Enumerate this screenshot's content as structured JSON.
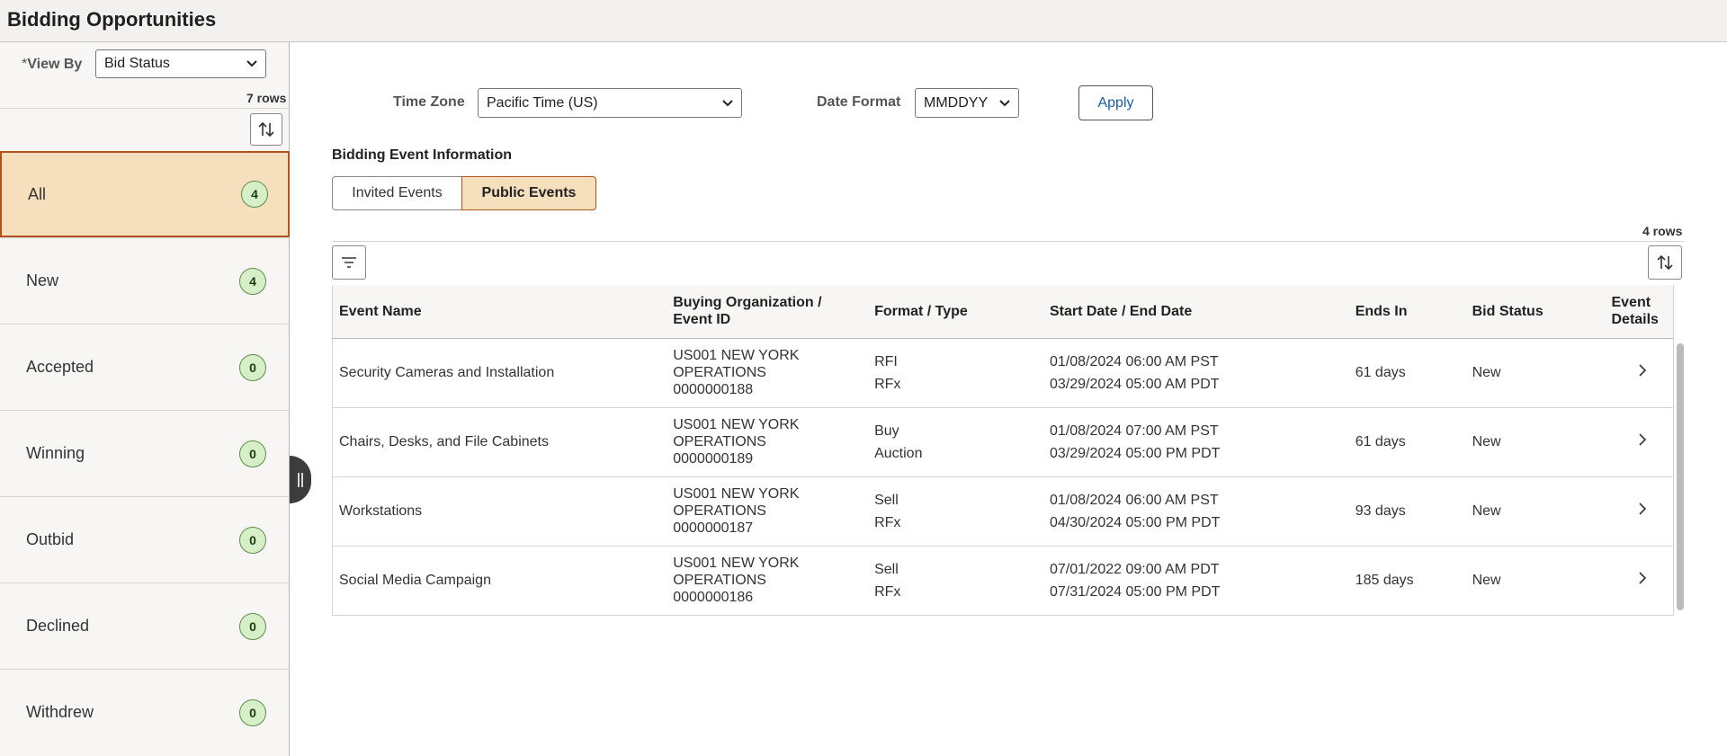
{
  "page": {
    "title": "Bidding Opportunities"
  },
  "sidebar": {
    "view_by_required": "*",
    "view_by_label": "View By",
    "view_by_value": "Bid Status",
    "rows_count": "7 rows",
    "items": [
      {
        "label": "All",
        "count": "4",
        "selected": true
      },
      {
        "label": "New",
        "count": "4"
      },
      {
        "label": "Accepted",
        "count": "0"
      },
      {
        "label": "Winning",
        "count": "0"
      },
      {
        "label": "Outbid",
        "count": "0"
      },
      {
        "label": "Declined",
        "count": "0"
      },
      {
        "label": "Withdrew",
        "count": "0"
      }
    ]
  },
  "filters": {
    "time_zone_label": "Time Zone",
    "time_zone_value": "Pacific Time (US)",
    "date_format_label": "Date Format",
    "date_format_value": "MMDDYY",
    "apply_label": "Apply"
  },
  "section": {
    "title": "Bidding Event Information",
    "tabs": [
      {
        "label": "Invited Events",
        "selected": false
      },
      {
        "label": "Public Events",
        "selected": true
      }
    ]
  },
  "grid": {
    "rows_count": "4 rows",
    "columns": [
      {
        "line1": "Event Name",
        "line2": ""
      },
      {
        "line1": "Buying Organization /",
        "line2": "Event ID"
      },
      {
        "line1": "Format / Type",
        "line2": ""
      },
      {
        "line1": "Start Date / End Date",
        "line2": ""
      },
      {
        "line1": "Ends In",
        "line2": ""
      },
      {
        "line1": "Bid Status",
        "line2": ""
      },
      {
        "line1": "Event",
        "line2": "Details"
      }
    ],
    "rows": [
      {
        "event_name": "Security Cameras and Installation",
        "org_line1": "US001 NEW YORK",
        "org_line2": "OPERATIONS",
        "event_id": "0000000188",
        "format": "RFI",
        "type": "RFx",
        "start": "01/08/2024 06:00 AM PST",
        "end": "03/29/2024 05:00 AM PDT",
        "ends_in": "61 days",
        "bid_status": "New"
      },
      {
        "event_name": "Chairs, Desks, and File Cabinets",
        "org_line1": "US001 NEW YORK",
        "org_line2": "OPERATIONS",
        "event_id": "0000000189",
        "format": "Buy",
        "type": "Auction",
        "start": "01/08/2024 07:00 AM PST",
        "end": "03/29/2024 05:00 PM PDT",
        "ends_in": "61 days",
        "bid_status": "New"
      },
      {
        "event_name": "Workstations",
        "org_line1": "US001 NEW YORK",
        "org_line2": "OPERATIONS",
        "event_id": "0000000187",
        "format": "Sell",
        "type": "RFx",
        "start": "01/08/2024 06:00 AM PST",
        "end": "04/30/2024 05:00 PM PDT",
        "ends_in": "93 days",
        "bid_status": "New"
      },
      {
        "event_name": "Social Media Campaign",
        "org_line1": "US001 NEW YORK",
        "org_line2": "OPERATIONS",
        "event_id": "0000000186",
        "format": "Sell",
        "type": "RFx",
        "start": "07/01/2022 09:00 AM PDT",
        "end": "07/31/2024 05:00 PM PDT",
        "ends_in": "185 days",
        "bid_status": "New"
      }
    ]
  },
  "icons": {
    "sort": "sort-icon",
    "filter": "filter-icon",
    "chevron_down": "chevron-down-icon",
    "chevron_right": "chevron-right-icon",
    "collapse": "collapse-handle-icon"
  },
  "colors": {
    "selected_bg": "#f6dfbd",
    "selected_border": "#b3521c",
    "badge_bg": "#d7efc9",
    "badge_border": "#5f8d45",
    "link_blue": "#1a5aa6"
  }
}
